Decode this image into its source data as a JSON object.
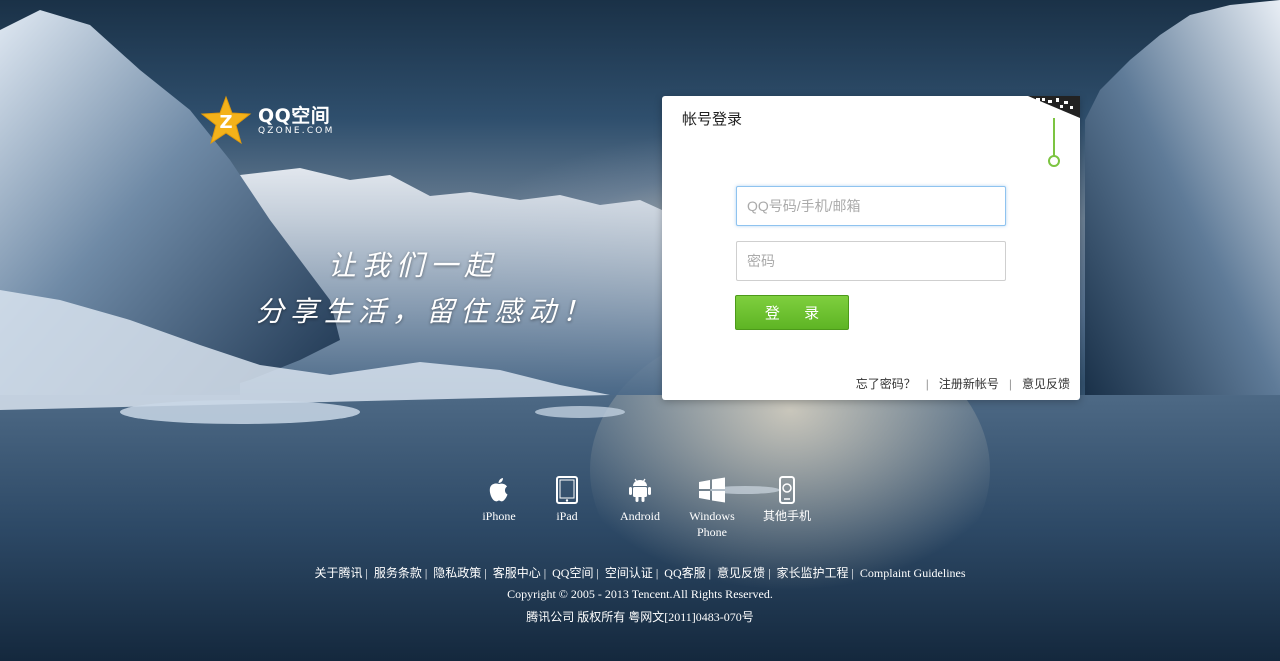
{
  "logo": {
    "brand": "QQ空间",
    "domain": "QZONE.COM"
  },
  "slogan": {
    "line1": "让我们一起",
    "line2": "分享生活，留住感动！"
  },
  "login": {
    "title": "帐号登录",
    "account_placeholder": "QQ号码/手机/邮箱",
    "password_placeholder": "密码",
    "submit_label": "登 录",
    "links": [
      "忘了密码？",
      "注册新帐号",
      "意见反馈"
    ]
  },
  "platforms": [
    {
      "label": "iPhone",
      "icon": "apple-icon"
    },
    {
      "label": "iPad",
      "icon": "tablet-icon"
    },
    {
      "label": "Android",
      "icon": "android-icon"
    },
    {
      "label": "Windows Phone",
      "icon": "windows-icon"
    },
    {
      "label": "其他手机",
      "icon": "phone-icon"
    }
  ],
  "footer": {
    "links": [
      "关于腾讯",
      "服务条款",
      "隐私政策",
      "客服中心",
      "QQ空间",
      "空间认证",
      "QQ客服",
      "意见反馈",
      "家长监护工程"
    ],
    "complaint": "Complaint Guidelines",
    "copyright": "Copyright © 2005 - 2013 Tencent.All Rights Reserved.",
    "license": "腾讯公司 版权所有 粤网文[2011]0483-070号"
  },
  "colors": {
    "accent_green": "#66bb2a",
    "logo_star": "#f4b21a",
    "input_focus": "#8fc3ef"
  }
}
